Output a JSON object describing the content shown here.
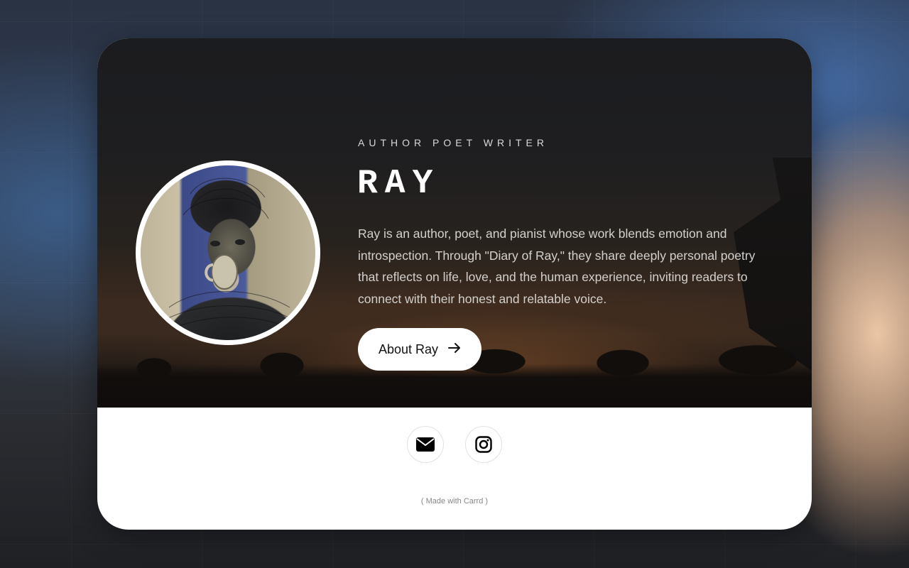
{
  "profile": {
    "subtitle": "AUTHOR POET WRITER",
    "name": "RAY",
    "bio": "Ray is an author, poet, and pianist whose work blends emotion and introspection. Through \"Diary of Ray,\" they share deeply personal poetry that reflects on life, love, and the human experience, inviting readers to connect with their honest and relatable voice.",
    "button_label": "About Ray",
    "button_icon": "arrow-right-icon"
  },
  "socials": [
    {
      "icon": "envelope-icon"
    },
    {
      "icon": "instagram-icon"
    }
  ],
  "footer": {
    "credit": "( Made with Carrd )"
  },
  "colors": {
    "card_bg": "#ffffff",
    "hero_text": "#ffffff",
    "bio_text": "#d4d0cc",
    "credit_text": "#888888"
  }
}
